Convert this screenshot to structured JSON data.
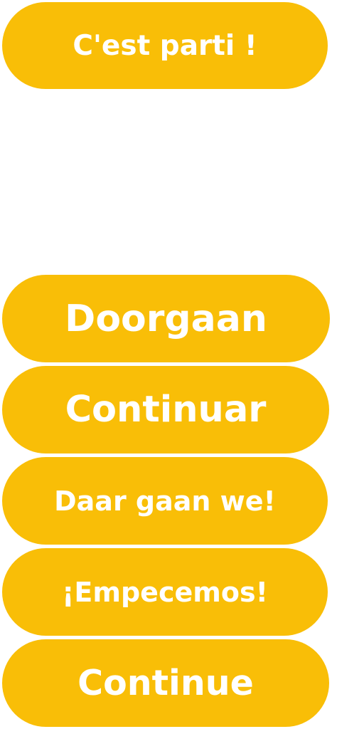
{
  "buttons": [
    {
      "label": "C'est parti !"
    },
    {
      "label": "Doorgaan"
    },
    {
      "label": "Continuar"
    },
    {
      "label": "Daar gaan we!"
    },
    {
      "label": "¡Empecemos!"
    },
    {
      "label": "Continue"
    }
  ],
  "colors": {
    "button_background": "#f9be07",
    "button_text": "#ffffff",
    "page_background": "#ffffff"
  }
}
